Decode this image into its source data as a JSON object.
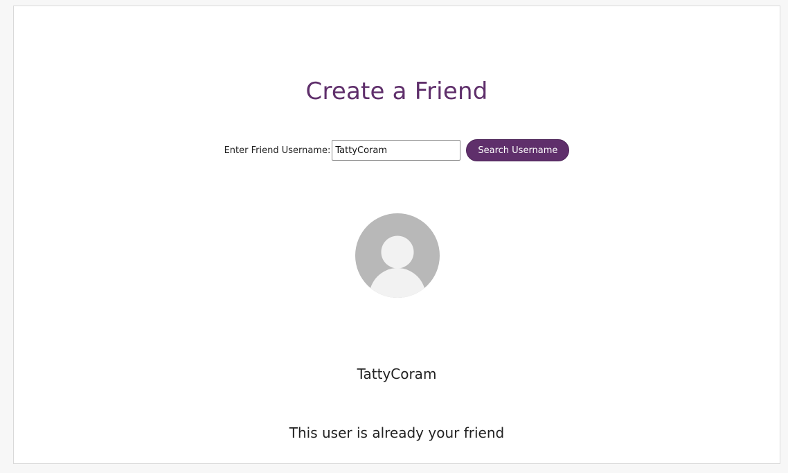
{
  "page": {
    "title": "Create a Friend"
  },
  "search": {
    "label": "Enter Friend Username:",
    "value": "TattyCoram",
    "button_label": "Search Username"
  },
  "result": {
    "avatar_icon": "default-user-avatar-icon",
    "username": "TattyCoram",
    "status_message": "This user is already your friend"
  },
  "colors": {
    "accent": "#5f2f6b",
    "avatar_bg": "#b8b8b8",
    "avatar_fg": "#f2f2f2"
  }
}
